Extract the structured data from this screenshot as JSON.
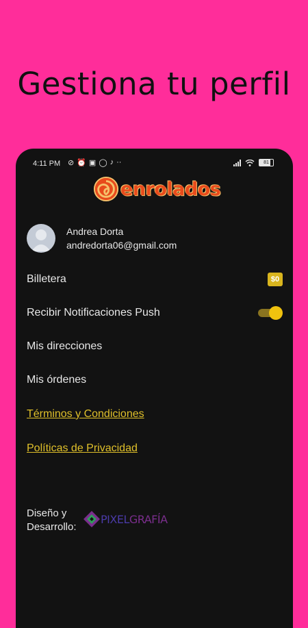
{
  "headline": "Gestiona tu perfil",
  "status_bar": {
    "time": "4:11 PM",
    "battery": "81"
  },
  "app": {
    "logo_text": "enrolados"
  },
  "profile": {
    "name": "Andrea Dorta",
    "email": "andredorta06@gmail.com"
  },
  "menu": {
    "wallet": {
      "label": "Billetera",
      "badge": "$0"
    },
    "push": {
      "label": "Recibir Notificaciones Push",
      "enabled": true
    },
    "addresses": {
      "label": "Mis direcciones"
    },
    "orders": {
      "label": "Mis órdenes"
    },
    "terms": {
      "label": "Términos y Condiciones"
    },
    "privacy": {
      "label": "Políticas de Privacidad"
    }
  },
  "credits": {
    "line1": "Diseño y",
    "line2": "Desarrollo:",
    "brand_part1": "PIXEL",
    "brand_part2": "GRAFÍA"
  },
  "colors": {
    "background": "#ff2d9a",
    "screen": "#121212",
    "accent": "#e0c02a",
    "logo": "#e84b1c"
  }
}
